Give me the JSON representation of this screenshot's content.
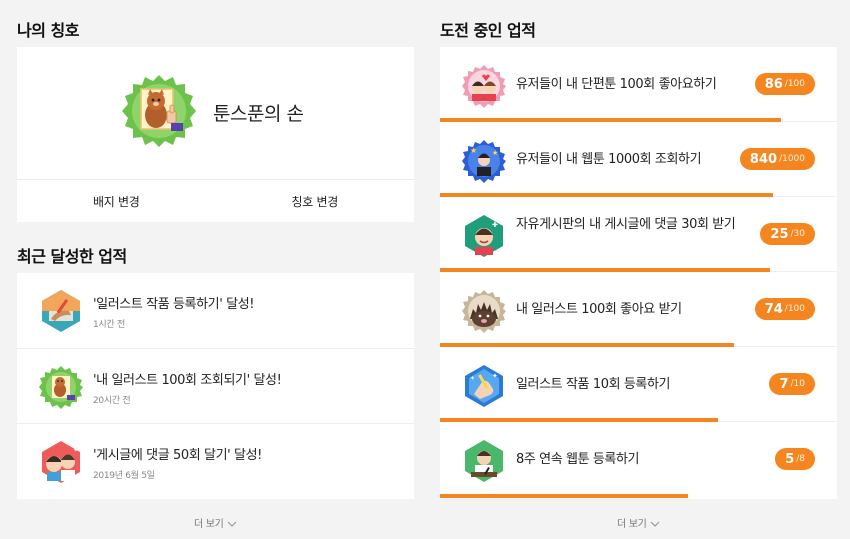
{
  "my_title": {
    "heading": "나의 칭호",
    "name": "툰스푼의 손",
    "badge_icon": "cat-thumbs-up-badge-icon",
    "actions": {
      "badge_change": "배지 변경",
      "title_change": "칭호 변경"
    }
  },
  "recent": {
    "heading": "최근 달성한 업적",
    "items": [
      {
        "title": "'일러스트 작품 등록하기' 달성!",
        "time": "1시간 전",
        "icon": "drawing-hand-icon"
      },
      {
        "title": "'내 일러스트 100회 조회되기' 달성!",
        "time": "20시간 전",
        "icon": "cat-badge-icon"
      },
      {
        "title": "'게시글에 댓글 50회 달기' 달성!",
        "time": "2019년 6월 5일",
        "icon": "comment-people-icon"
      }
    ],
    "more": "더 보기"
  },
  "progress": {
    "heading": "도전 중인 업적",
    "items": [
      {
        "title": "유저들이 내 단편툰 100회 좋아요하기",
        "current": "86",
        "total": "/100",
        "ratio": 0.86,
        "icon": "couple-hearts-icon"
      },
      {
        "title": "유저들이 내 웹툰 1000회 조회하기",
        "current": "840",
        "total": "/1000",
        "ratio": 0.84,
        "icon": "star-person-icon"
      },
      {
        "title": "자유게시판의 내 게시글에 댓글 30회 받기",
        "current": "25",
        "total": "/30",
        "ratio": 0.83,
        "icon": "smiling-boy-icon"
      },
      {
        "title": "내 일러스트 100회 좋아요 받기",
        "current": "74",
        "total": "/100",
        "ratio": 0.74,
        "icon": "hedgehog-icon"
      },
      {
        "title": "일러스트 작품 10회 등록하기",
        "current": "7",
        "total": "/10",
        "ratio": 0.7,
        "icon": "pen-hand-icon"
      },
      {
        "title": "8주 연속 웹툰 등록하기",
        "current": "5",
        "total": "/8",
        "ratio": 0.625,
        "icon": "boy-drawing-icon"
      }
    ],
    "more": "더 보기"
  },
  "colors": {
    "accent": "#f5861f",
    "background": "#f3f3f3",
    "card": "#ffffff"
  }
}
